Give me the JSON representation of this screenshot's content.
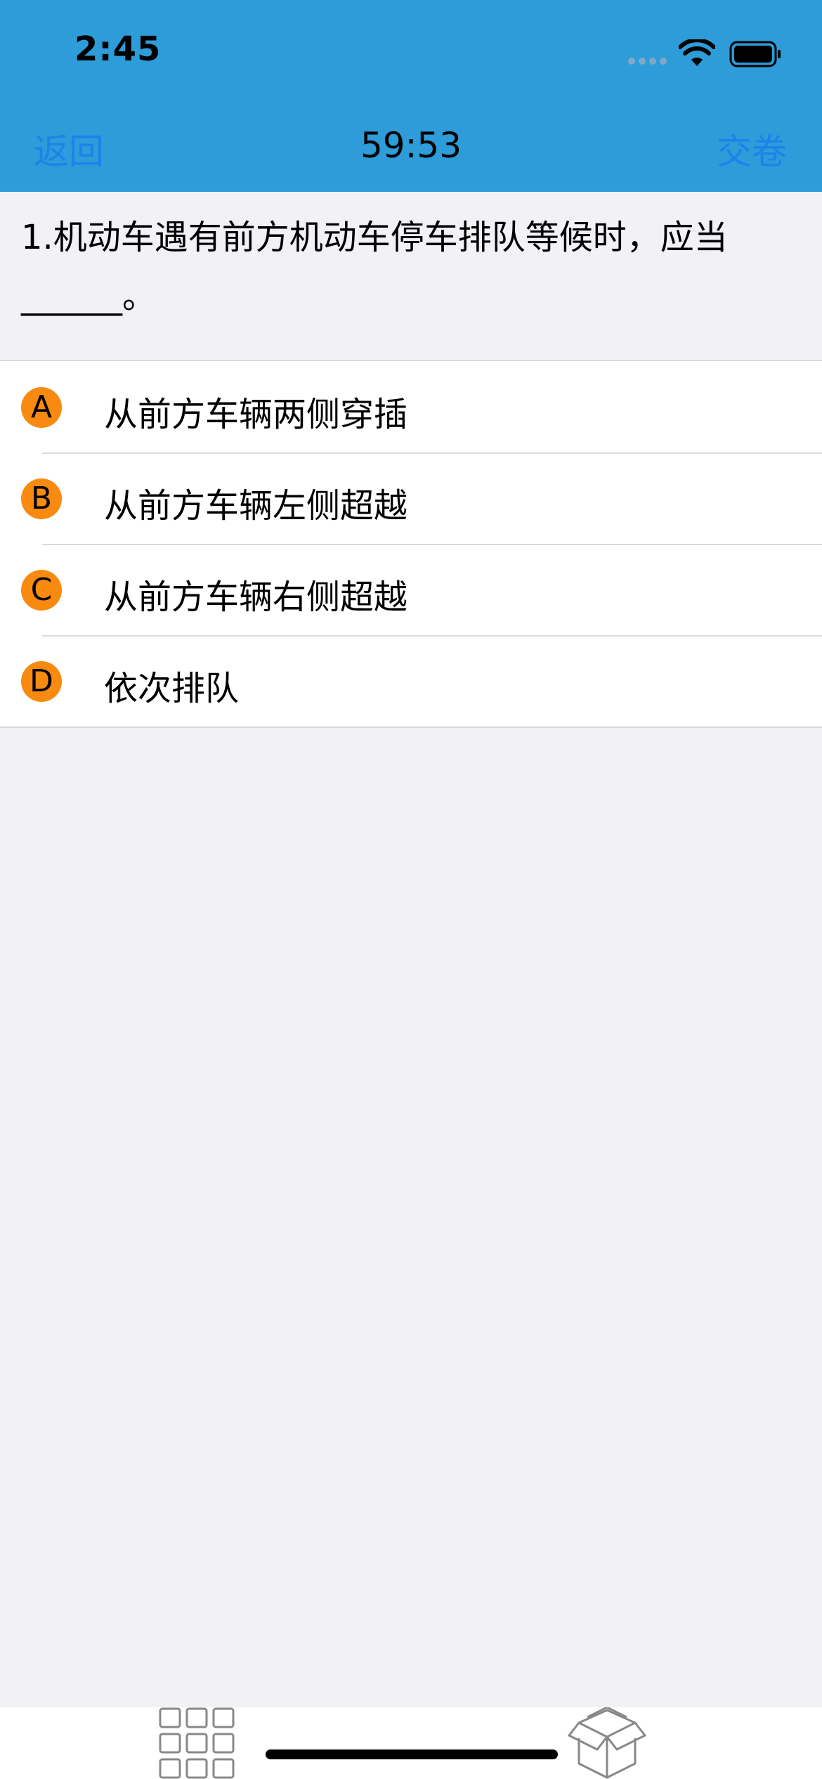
{
  "status_bar": {
    "time": "2:45"
  },
  "nav": {
    "back_label": "返回",
    "timer": "59:53",
    "submit_label": "交卷"
  },
  "question": {
    "text": "1.机动车遇有前方机动车停车排队等候时，应当______。"
  },
  "options": [
    {
      "letter": "A",
      "text": "从前方车辆两侧穿插"
    },
    {
      "letter": "B",
      "text": "从前方车辆左侧超越"
    },
    {
      "letter": "C",
      "text": "从前方车辆右侧超越"
    },
    {
      "letter": "D",
      "text": "依次排队"
    }
  ],
  "bottom_bar": {
    "left_icon": "grid-icon",
    "right_icon": "box-icon"
  },
  "colors": {
    "header_bg": "#2d9cd8",
    "link": "#1a84ea",
    "badge": "#f98a10",
    "page_bg": "#f1f1f6"
  }
}
